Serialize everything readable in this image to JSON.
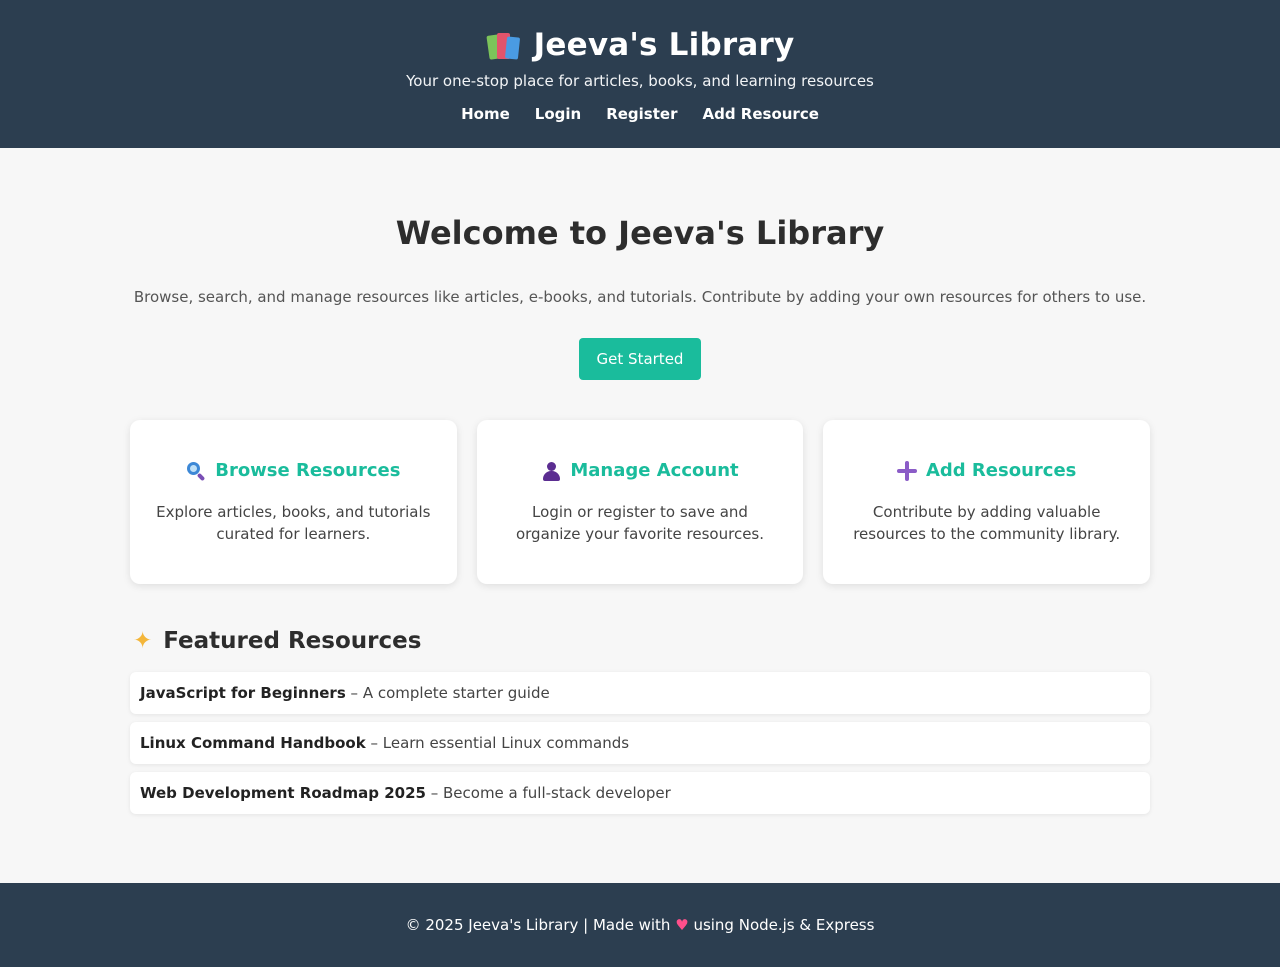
{
  "header": {
    "icon": "books-icon",
    "title": "Jeeva's Library",
    "tagline": "Your one-stop place for articles, books, and learning resources",
    "nav": [
      "Home",
      "Login",
      "Register",
      "Add Resource"
    ]
  },
  "hero": {
    "title": "Welcome to Jeeva's Library",
    "description": "Browse, search, and manage resources like articles, e-books, and tutorials. Contribute by adding your own resources for others to use.",
    "cta_label": "Get Started"
  },
  "cards": [
    {
      "icon": "magnifier-icon",
      "title": "Browse Resources",
      "description": "Explore articles, books, and tutorials curated for learners."
    },
    {
      "icon": "user-icon",
      "title": "Manage Account",
      "description": "Login or register to save and organize your favorite resources."
    },
    {
      "icon": "plus-icon",
      "title": "Add Resources",
      "description": "Contribute by adding valuable resources to the community library."
    }
  ],
  "featured": {
    "icon": "sparkles-icon",
    "title": "Featured Resources",
    "items": [
      {
        "name": "JavaScript for Beginners",
        "sep": " – ",
        "desc": "A complete starter guide"
      },
      {
        "name": "Linux Command Handbook",
        "sep": " – ",
        "desc": "Learn essential Linux commands"
      },
      {
        "name": "Web Development Roadmap 2025",
        "sep": " – ",
        "desc": "Become a full-stack developer"
      }
    ]
  },
  "footer": {
    "before": "© 2025 Jeeva's Library | Made with ",
    "heart": "♥",
    "after": " using Node.js & Express"
  },
  "colors": {
    "header_bg": "#2c3e50",
    "accent": "#1abc9c",
    "page_bg": "#f7f7f7"
  }
}
